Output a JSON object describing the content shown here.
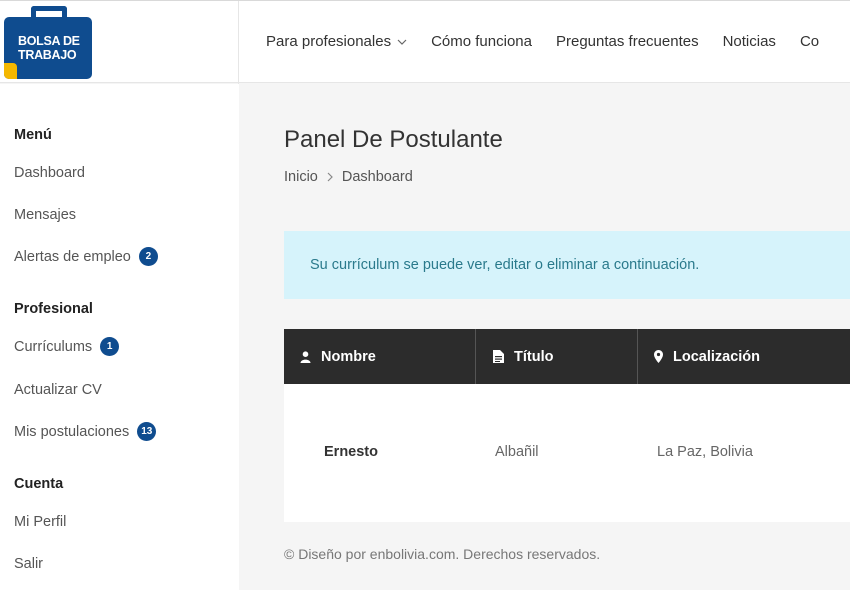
{
  "brand": {
    "line1": "BOLSA DE",
    "line2": "TRABAJO"
  },
  "nav": [
    {
      "label": "Para profesionales",
      "has_dropdown": true
    },
    {
      "label": "Cómo funciona"
    },
    {
      "label": "Preguntas frecuentes"
    },
    {
      "label": "Noticias"
    },
    {
      "label": "Co"
    }
  ],
  "sidebar": {
    "sections": [
      {
        "title": "Menú",
        "items": [
          {
            "label": "Dashboard"
          },
          {
            "label": "Mensajes"
          },
          {
            "label": "Alertas de empleo",
            "badge": "2"
          }
        ]
      },
      {
        "title": "Profesional",
        "items": [
          {
            "label": "Currículums",
            "badge": "1"
          },
          {
            "label": "Actualizar CV"
          },
          {
            "label": "Mis postulaciones",
            "badge": "13"
          }
        ]
      },
      {
        "title": "Cuenta",
        "items": [
          {
            "label": "Mi Perfil"
          },
          {
            "label": "Salir"
          }
        ]
      }
    ]
  },
  "main": {
    "title": "Panel De Postulante",
    "breadcrumb": {
      "home": "Inicio",
      "current": "Dashboard"
    },
    "alert": "Su currículum se puede ver, editar o eliminar a continuación.",
    "table": {
      "headers": {
        "name": "Nombre",
        "title": "Título",
        "location": "Localización"
      },
      "rows": [
        {
          "name": "Ernesto",
          "title": "Albañil",
          "location": "La Paz, Bolivia"
        }
      ]
    }
  },
  "footer": "© Diseño por enbolivia.com. Derechos reservados.",
  "colors": {
    "brand": "#0f4c8f",
    "accent": "#f5b800",
    "alert_bg": "#d6f3fb",
    "table_header": "#2c2c2c"
  }
}
